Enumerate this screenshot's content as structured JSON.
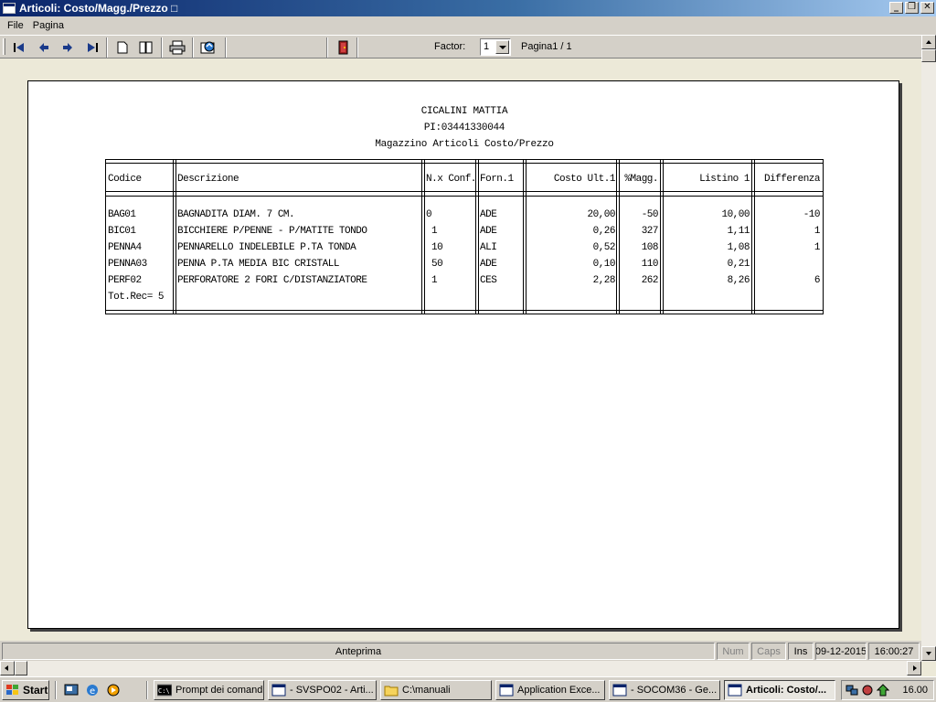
{
  "window": {
    "title": "Articoli: Costo/Magg./Prezzo □",
    "buttons": [
      "_",
      "❒",
      "✕"
    ]
  },
  "menu": {
    "items": [
      "File",
      "Pagina"
    ]
  },
  "toolbar": {
    "factor_label": "Factor:",
    "factor_value": "1",
    "page_info": "Pagina1 / 1",
    "icons": [
      "first-page-icon",
      "prev-page-icon",
      "next-page-icon",
      "last-page-icon",
      "single-page-icon",
      "two-page-icon",
      "print-icon",
      "export-icon",
      "exit-door-icon"
    ]
  },
  "report": {
    "company": "CICALINI MATTIA",
    "vat": "PI:03441330044",
    "title": "Magazzino Articoli Costo/Prezzo",
    "columns": [
      "Codice",
      "Descrizione",
      "N.x Conf.",
      "Forn.1",
      "Costo Ult.1",
      "%Magg.",
      "Listino 1",
      "Differenza"
    ],
    "rows": [
      [
        "BAG01",
        "BAGNADITA DIAM. 7 CM.",
        "0",
        "ADE",
        "20,00",
        "-50",
        "10,00",
        "-10"
      ],
      [
        "BIC01",
        "BICCHIERE P/PENNE - P/MATITE TONDO",
        "1",
        "ADE",
        "0,26",
        "327",
        "1,11",
        "1"
      ],
      [
        "PENNA4",
        "PENNARELLO INDELEBILE P.TA TONDA",
        "10",
        "ALI",
        "0,52",
        "108",
        "1,08",
        "1"
      ],
      [
        "PENNA03",
        "PENNA P.TA MEDIA BIC CRISTALL",
        "50",
        "ADE",
        "0,10",
        "110",
        "0,21",
        ""
      ],
      [
        "PERF02",
        "PERFORATORE 2 FORI C/DISTANZIATORE",
        "1",
        "CES",
        "2,28",
        "262",
        "8,26",
        "6"
      ]
    ],
    "total": "Tot.Rec= 5"
  },
  "status": {
    "mode": "Anteprima",
    "num": "Num",
    "caps": "Caps",
    "ins": "Ins",
    "date": "09-12-2015",
    "time": "16:00:27"
  },
  "taskbar": {
    "start": "Start",
    "tasks": [
      "Prompt dei comandi",
      "- SVSPO02 - Arti...",
      "C:\\manuali",
      "Application Exce...",
      "- SOCOM36 - Ge...",
      "Articoli: Costo/..."
    ],
    "clock": "16.00"
  }
}
